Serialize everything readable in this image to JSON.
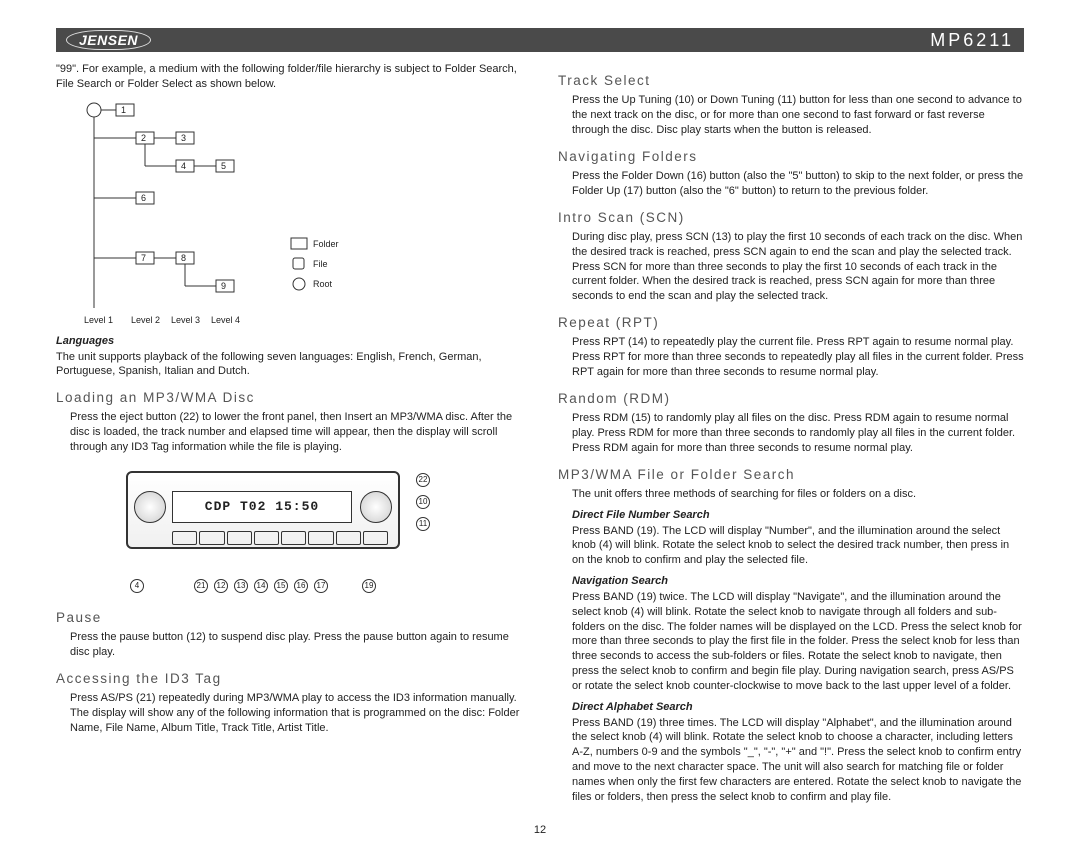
{
  "header": {
    "brand": "JENSEN",
    "model": "MP6211"
  },
  "left": {
    "intro": "\"99\". For example, a medium with the following folder/file hierarchy is subject to Folder Search, File Search or Folder Select as shown below.",
    "tree": {
      "legend_folder": "Folder",
      "legend_file": "File",
      "legend_root": "Root",
      "level1": "Level 1",
      "level2": "Level 2",
      "level3": "Level 3",
      "level4": "Level 4",
      "n1": "1",
      "n2": "2",
      "n3": "3",
      "n4": "4",
      "n5": "5",
      "n6": "6",
      "n7": "7",
      "n8": "8",
      "n9": "9"
    },
    "languages_h": "Languages",
    "languages": "The unit supports playback of the following seven languages: English, French, German, Portuguese, Spanish, Italian and Dutch.",
    "loading_h": "Loading an MP3/WMA Disc",
    "loading": "Press the eject button (22) to lower the front panel, then Insert an MP3/WMA disc. After the disc is loaded, the track number and elapsed time will appear, then the display will scroll through any ID3 Tag information while the file is playing.",
    "radio_screen": "CDP T02 15:50",
    "callouts": {
      "c22": "22",
      "c10": "10",
      "c11": "11",
      "c4": "4",
      "c21": "21",
      "c12": "12",
      "c13": "13",
      "c14": "14",
      "c15": "15",
      "c16": "16",
      "c17": "17",
      "c19": "19"
    },
    "pause_h": "Pause",
    "pause": "Press the pause button (12) to suspend disc play. Press the pause button again to resume disc play.",
    "id3_h": "Accessing the ID3 Tag",
    "id3": "Press AS/PS (21) repeatedly during MP3/WMA play to access the ID3 information manually. The display will show any of the following information that is programmed on the disc: Folder Name, File Name, Album Title, Track Title, Artist Title."
  },
  "right": {
    "track_h": "Track Select",
    "track": "Press the Up Tuning (10) or Down Tuning (11) button for less than one second to advance to the next track on the disc, or for more than one second to fast forward or fast reverse through the disc. Disc play starts when the button is released.",
    "nav_h": "Navigating Folders",
    "nav": "Press the Folder Down (16) button (also the \"5\" button) to skip to the next folder, or press the Folder Up (17) button (also the \"6\" button) to return to the previous folder.",
    "scn_h": "Intro Scan (SCN)",
    "scn": "During disc play, press SCN (13) to play the first 10 seconds of each track on the disc. When the desired track is reached, press SCN again to end the scan and play the selected track. Press SCN for more than three seconds to play the first 10 seconds of each track in the current folder. When the desired track is reached, press SCN again for more than three seconds to end the scan and play the selected track.",
    "rpt_h": "Repeat (RPT)",
    "rpt": "Press RPT (14) to repeatedly play the current file. Press RPT again to resume normal play. Press RPT for more than three seconds to repeatedly play all files in the current folder. Press RPT again for more than three seconds to resume normal play.",
    "rdm_h": "Random (RDM)",
    "rdm": "Press RDM (15) to randomly play all files on the disc. Press RDM again to resume normal play. Press RDM for more than three seconds to randomly play all files in the current folder. Press RDM again for more than three seconds to resume normal play.",
    "search_h": "MP3/WMA File or Folder Search",
    "search_intro": "The unit offers three methods of searching for files or folders on a disc.",
    "dfn_h": "Direct File Number Search",
    "dfn": "Press BAND (19). The LCD will display \"Number\", and the illumination around the select knob (4) will blink. Rotate the select knob to select the desired track number, then press in on the knob to confirm and play the selected file.",
    "navs_h": "Navigation Search",
    "navs": "Press BAND (19) twice. The LCD will display \"Navigate\", and the illumination around the select knob (4) will blink. Rotate the select knob to navigate through all folders and sub-folders on the disc. The folder names will be displayed on the LCD. Press the select knob for more than three seconds to play the first file in the folder. Press the select knob for less than three seconds to access the sub-folders or files. Rotate the select knob to navigate, then press the select knob to confirm and begin file play. During navigation search, press AS/PS or rotate the select knob counter-clockwise to move back to the last upper level of a folder.",
    "das_h": "Direct Alphabet Search",
    "das": "Press BAND (19) three times. The LCD will display \"Alphabet\", and the illumination around the select knob (4) will blink. Rotate the select knob to choose a character, including letters A-Z, numbers 0-9 and the symbols \"_\", \"-\", \"+\" and \"!\". Press the select knob to confirm entry and move to the next character space. The unit will also search for matching file or folder names when only the first few characters are entered. Rotate the select knob to navigate the files or folders, then press the select knob to confirm and play file."
  },
  "page_number": "12"
}
